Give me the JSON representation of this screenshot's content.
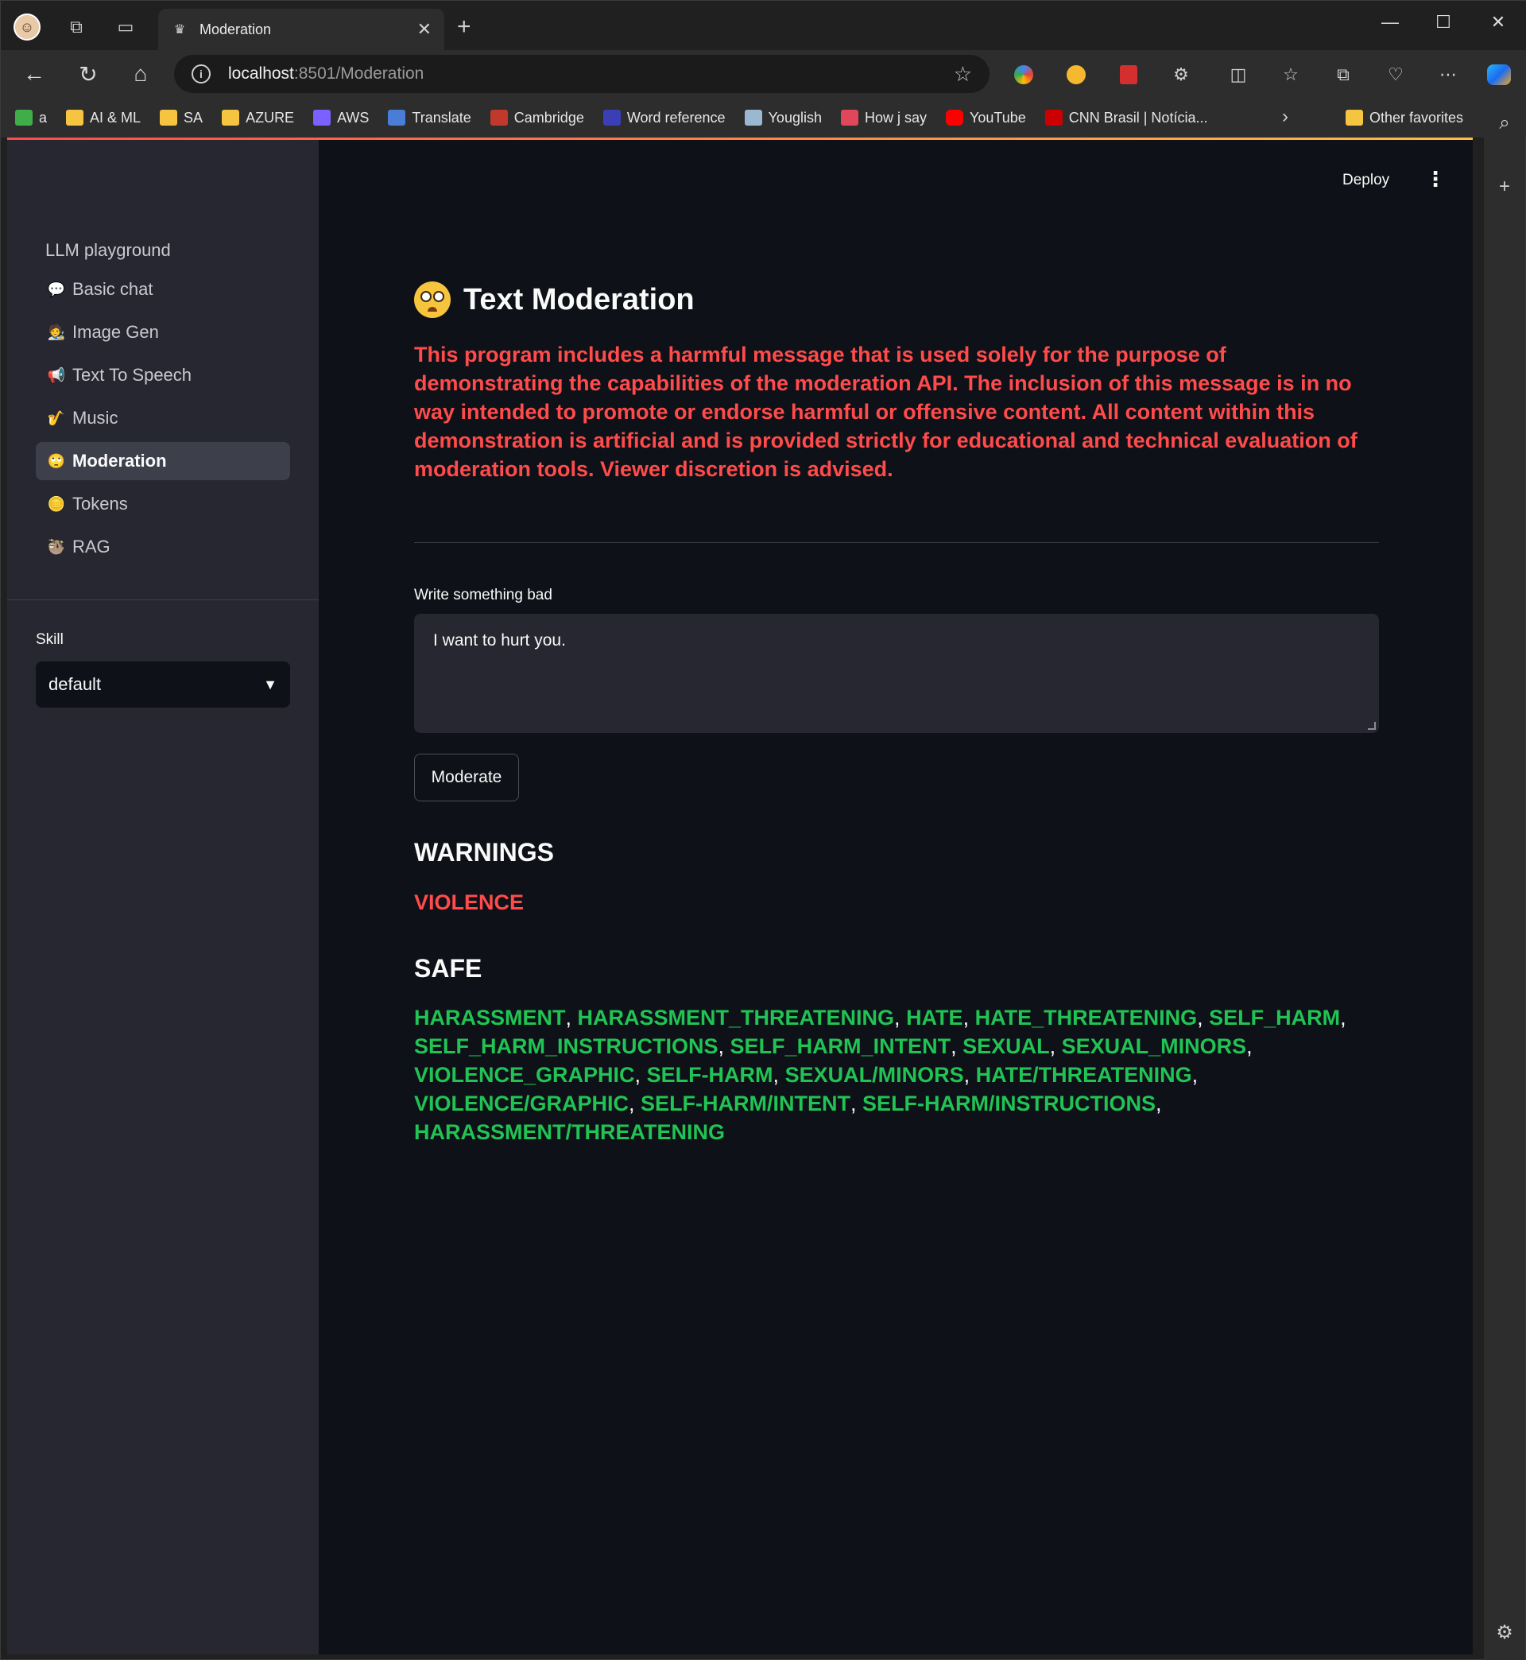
{
  "browser": {
    "tab_title": "Moderation",
    "url_host": "localhost",
    "url_rest": ":8501/Moderation",
    "bookmarks": [
      {
        "label": "a",
        "icon": "code-icon"
      },
      {
        "label": "AI & ML",
        "icon": "folder-icon"
      },
      {
        "label": "SA",
        "icon": "folder-icon"
      },
      {
        "label": "AZURE",
        "icon": "folder-icon"
      },
      {
        "label": "AWS",
        "icon": "cube-icon"
      },
      {
        "label": "Translate",
        "icon": "translate-icon"
      },
      {
        "label": "Cambridge",
        "icon": "cambridge-icon"
      },
      {
        "label": "Word reference",
        "icon": "wordreference-icon"
      },
      {
        "label": "Youglish",
        "icon": "youglish-icon"
      },
      {
        "label": "How j say",
        "icon": "howjsay-icon"
      },
      {
        "label": "YouTube",
        "icon": "youtube-icon"
      },
      {
        "label": "CNN Brasil | Notícia...",
        "icon": "cnn-icon"
      }
    ],
    "other_favorites": "Other favorites"
  },
  "app": {
    "deploy_label": "Deploy",
    "sidebar": {
      "heading": "LLM playground",
      "items": [
        {
          "label": "Basic chat",
          "emoji": "💬"
        },
        {
          "label": "Image Gen",
          "emoji": "🧑‍🎨"
        },
        {
          "label": "Text To Speech",
          "emoji": "📢"
        },
        {
          "label": "Music",
          "emoji": "🎷"
        },
        {
          "label": "Moderation",
          "emoji": "🙄"
        },
        {
          "label": "Tokens",
          "emoji": "🪙"
        },
        {
          "label": "RAG",
          "emoji": "🦥"
        }
      ],
      "active_index": 4,
      "skill_label": "Skill",
      "skill_value": "default"
    },
    "title": "Text Moderation",
    "disclaimer": "This program includes a harmful message that is used solely for the purpose of demonstrating the capabilities of the moderation API. The inclusion of this message is in no way intended to promote or endorse harmful or offensive content. All content within this demonstration is artificial and is provided strictly for educational and technical evaluation of moderation tools. Viewer discretion is advised.",
    "input_label": "Write something bad",
    "input_value": "I want to hurt you.",
    "button_label": "Moderate",
    "warnings_heading": "WARNINGS",
    "warnings": [
      "VIOLENCE"
    ],
    "safe_heading": "SAFE",
    "safe": [
      "HARASSMENT",
      "HARASSMENT_THREATENING",
      "HATE",
      "HATE_THREATENING",
      "SELF_HARM",
      "SELF_HARM_INSTRUCTIONS",
      "SELF_HARM_INTENT",
      "SEXUAL",
      "SEXUAL_MINORS",
      "VIOLENCE_GRAPHIC",
      "SELF-HARM",
      "SEXUAL/MINORS",
      "HATE/THREATENING",
      "VIOLENCE/GRAPHIC",
      "SELF-HARM/INTENT",
      "SELF-HARM/INSTRUCTIONS",
      "HARASSMENT/THREATENING"
    ],
    "colors": {
      "warning": "#ff4b4b",
      "safe": "#21c354",
      "background": "#0e1117",
      "sidebar": "#262730"
    }
  }
}
